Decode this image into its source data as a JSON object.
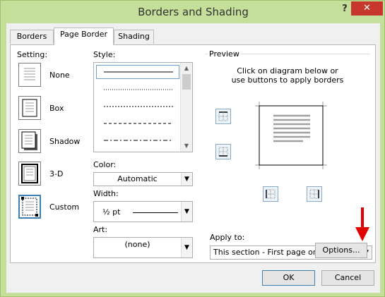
{
  "window": {
    "title": "Borders and Shading",
    "help_label": "?",
    "close_label": "✕"
  },
  "tabs": [
    {
      "label": "Borders",
      "access_key": "B"
    },
    {
      "label": "Page Border",
      "access_key": "P"
    },
    {
      "label": "Shading",
      "access_key": "S"
    }
  ],
  "setting": {
    "label": "Setting:",
    "items": [
      {
        "label": "None",
        "access_key": "N"
      },
      {
        "label": "Box",
        "access_key": "x"
      },
      {
        "label": "Shadow",
        "access_key": "a"
      },
      {
        "label": "3-D",
        "access_key": "D"
      },
      {
        "label": "Custom",
        "access_key": "U"
      }
    ]
  },
  "style": {
    "label": "Style:",
    "access_key": "y"
  },
  "color": {
    "label": "Color:",
    "value": "Automatic"
  },
  "width": {
    "label": "Width:",
    "value": "½ pt"
  },
  "art": {
    "label": "Art:",
    "value": "(none)"
  },
  "preview": {
    "label": "Preview",
    "instruction_line1": "Click on diagram below or",
    "instruction_line2": "use buttons to apply borders"
  },
  "apply_to": {
    "label": "Apply to:",
    "value": "This section - First page only"
  },
  "buttons": {
    "options": "Options...",
    "ok": "OK",
    "cancel": "Cancel"
  },
  "colors": {
    "frame": "#c3df9a",
    "close": "#c7362b",
    "arrow": "#e00000",
    "selection": "#3c7fb1"
  }
}
